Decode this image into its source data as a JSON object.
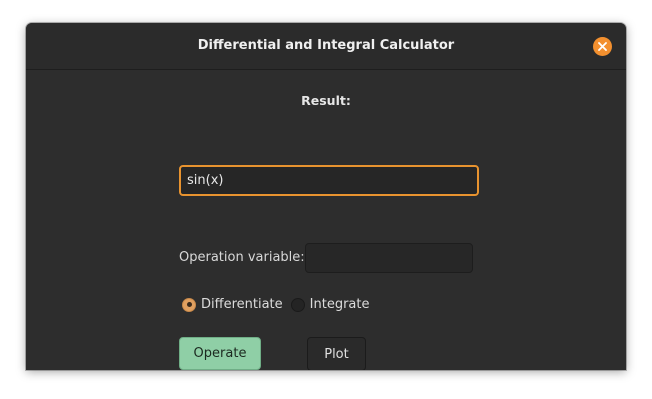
{
  "window": {
    "title": "Differential and Integral Calculator"
  },
  "result": {
    "label": "Result:"
  },
  "expression": {
    "value": "sin(x)"
  },
  "operation_variable": {
    "label": "Operation variable:",
    "value": ""
  },
  "mode": {
    "options": [
      {
        "label": "Differentiate",
        "selected": true
      },
      {
        "label": "Integrate",
        "selected": false
      }
    ]
  },
  "buttons": {
    "operate_label": "Operate",
    "plot_label": "Plot"
  },
  "icons": {
    "close": "close-icon"
  },
  "colors": {
    "accent": "#f3902f",
    "focus_border": "#e8932f",
    "suggested_action": "#8fcfa6",
    "window_bg": "#2d2d2d"
  }
}
